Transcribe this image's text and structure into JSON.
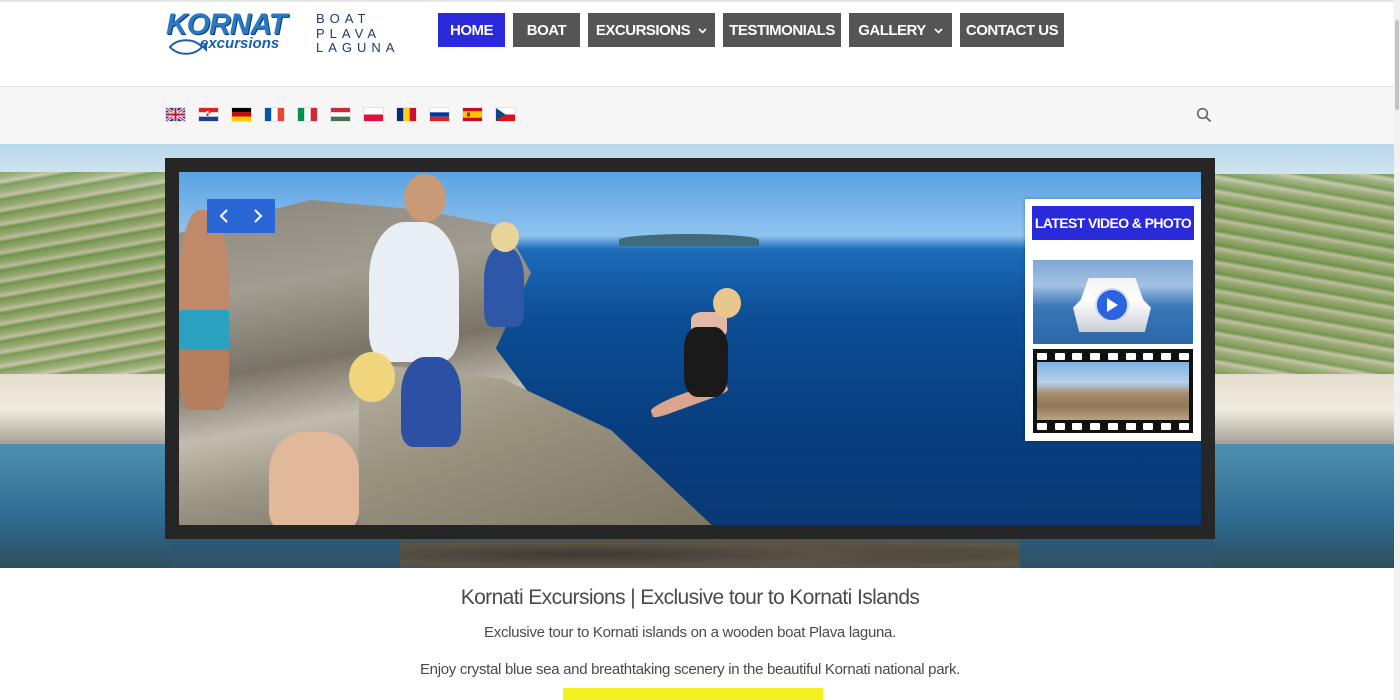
{
  "brand": {
    "logo_word": "KORNAT",
    "logo_sub": "excursions",
    "boat_lines": [
      "BOAT",
      "PLAVA",
      "LAGUNA"
    ]
  },
  "nav": {
    "items": [
      {
        "label": "HOME",
        "active": true,
        "dropdown": false
      },
      {
        "label": "BOAT",
        "active": false,
        "dropdown": false
      },
      {
        "label": "EXCURSIONS",
        "active": false,
        "dropdown": true
      },
      {
        "label": "TESTIMONIALS",
        "active": false,
        "dropdown": false
      },
      {
        "label": "GALLERY",
        "active": false,
        "dropdown": true
      },
      {
        "label": "CONTACT US",
        "active": false,
        "dropdown": false
      }
    ]
  },
  "languages": [
    "english-flag",
    "croatian-flag",
    "german-flag",
    "french-flag",
    "italian-flag",
    "hungarian-flag",
    "polish-flag",
    "romanian-flag",
    "russian-flag",
    "spanish-flag",
    "czech-flag"
  ],
  "slider": {
    "latest_label": "LATEST VIDEO & PHOTO"
  },
  "content": {
    "headline": "Kornati Excursions | Exclusive tour to Kornati Islands",
    "line1": "Exclusive tour to Kornati islands on a wooden boat Plava laguna.",
    "line2": "Enjoy crystal blue sea and breathtaking scenery in the beautiful Kornati national park."
  },
  "colors": {
    "nav_active": "#2a2adb",
    "nav_default": "#555555",
    "brand_blue": "#2a79c2",
    "phone_highlight": "#f3f21f"
  }
}
